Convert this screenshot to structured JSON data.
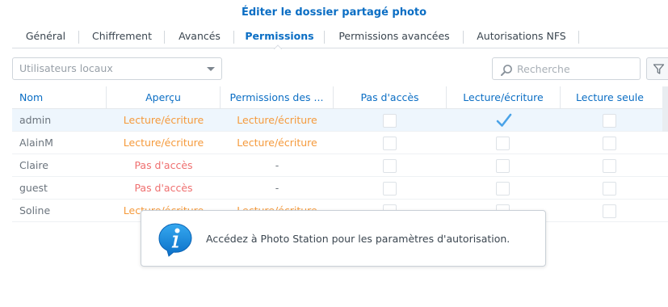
{
  "dialog": {
    "title": "Éditer le dossier partagé photo"
  },
  "tabs": [
    {
      "label": "Général"
    },
    {
      "label": "Chiffrement"
    },
    {
      "label": "Avancés"
    },
    {
      "label": "Permissions",
      "active": true
    },
    {
      "label": "Permissions avancées"
    },
    {
      "label": "Autorisations NFS"
    }
  ],
  "toolbar": {
    "user_type_select": "Utilisateurs locaux",
    "search_placeholder": "Recherche"
  },
  "table": {
    "columns": [
      "Nom",
      "Aperçu",
      "Permissions des ...",
      "Pas d'accès",
      "Lecture/écriture",
      "Lecture seule"
    ],
    "rows": [
      {
        "name": "admin",
        "apercu": "Lecture/écriture",
        "permissions": "Lecture/écriture",
        "no_access": false,
        "read_write": true,
        "read_only": false
      },
      {
        "name": "AlainM",
        "apercu": "Lecture/écriture",
        "permissions": "Lecture/écriture",
        "no_access": false,
        "read_write": false,
        "read_only": false
      },
      {
        "name": "Claire",
        "apercu": "Pas d'accès",
        "permissions": "-",
        "no_access": false,
        "read_write": false,
        "read_only": false
      },
      {
        "name": "guest",
        "apercu": "Pas d'accès",
        "permissions": "-",
        "no_access": false,
        "read_write": false,
        "read_only": false
      },
      {
        "name": "Soline",
        "apercu": "Lecture/écriture",
        "permissions": "Lecture/écriture",
        "no_access": false,
        "read_write": false,
        "read_only": false
      }
    ],
    "selected_row": 0
  },
  "toast": {
    "message": "Accédez à Photo Station pour les paramètres d'autorisation."
  },
  "colors": {
    "accent": "#0b6ec4",
    "read_write": "#f59a3c",
    "no_access": "#ef6f6f",
    "selected_row": "#eef6fd"
  },
  "icons": {
    "search": "magnifier-icon",
    "filter": "funnel-icon",
    "info": "info-bubble-icon",
    "check": "checkmark-icon"
  }
}
